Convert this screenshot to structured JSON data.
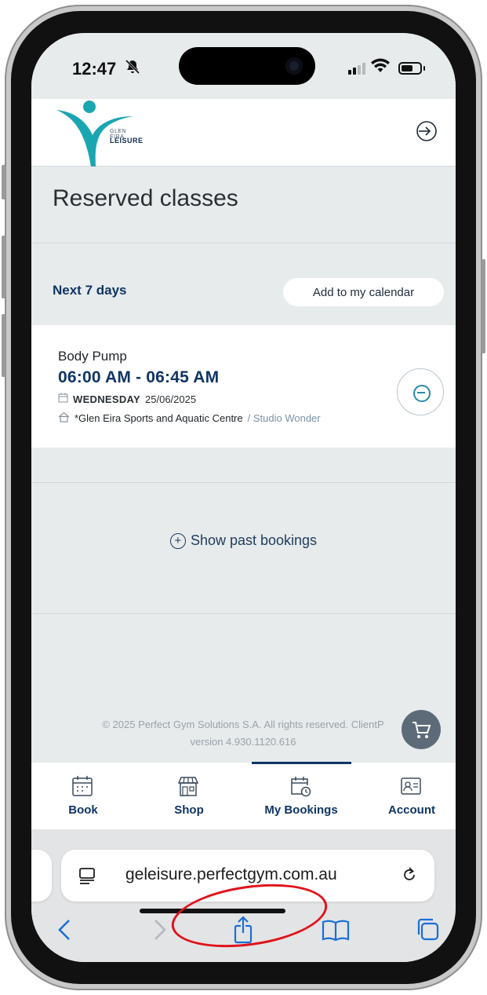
{
  "status_bar": {
    "time": "12:47",
    "silent_icon": "bell-slash-icon"
  },
  "header": {
    "logo_text_small": "GLEN EIRA",
    "logo_text_big": "LEISURE",
    "logout_icon": "logout-icon"
  },
  "page": {
    "title": "Reserved classes"
  },
  "section": {
    "label": "Next 7 days",
    "calendar_button": "Add to my calendar"
  },
  "booking": {
    "class_name": "Body Pump",
    "time_range": "06:00 AM - 06:45 AM",
    "weekday": "WEDNESDAY",
    "date": "25/06/2025",
    "location": "*Glen Eira Sports and Aquatic Centre",
    "studio": "/ Studio Wonder"
  },
  "past_bookings": {
    "label": "Show past bookings"
  },
  "footer": {
    "copyright": "© 2025 Perfect Gym Solutions S.A. All rights reserved. ClientP",
    "version": "version 4.930.1120.616"
  },
  "tabs": [
    {
      "label": "Book",
      "icon": "calendar-icon"
    },
    {
      "label": "Shop",
      "icon": "shop-icon"
    },
    {
      "label": "My Bookings",
      "icon": "bookings-icon"
    },
    {
      "label": "Account",
      "icon": "account-icon"
    }
  ],
  "browser": {
    "url": "geleisure.perfectgym.com.au"
  },
  "colors": {
    "brand_navy": "#0f3564",
    "brand_teal": "#1aa6b0",
    "page_bg": "#e7ebec",
    "annotation_red": "#e0131b"
  }
}
